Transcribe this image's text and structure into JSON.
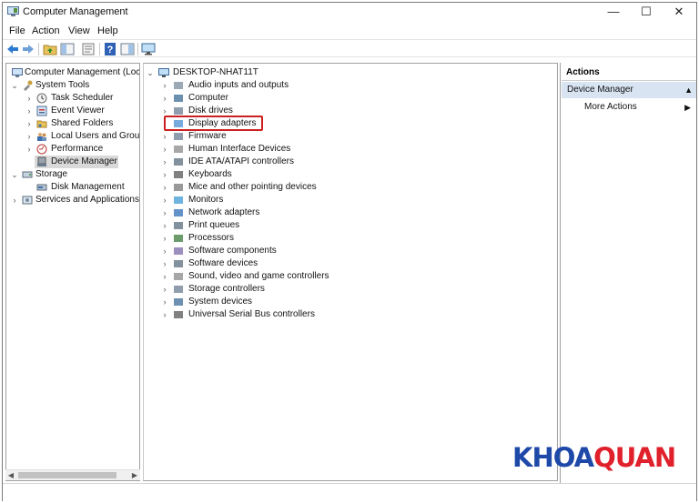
{
  "window": {
    "title": "Computer Management",
    "controls": {
      "minimize": "—",
      "maximize": "☐",
      "close": "✕"
    }
  },
  "menu": [
    "File",
    "Action",
    "View",
    "Help"
  ],
  "toolbar_icons": [
    "back-arrow-icon",
    "forward-arrow-icon",
    "up-folder-icon",
    "show-hide-tree-icon",
    "properties-icon",
    "help-icon",
    "action-pane-icon",
    "monitor-icon"
  ],
  "left_tree": {
    "root": "Computer Management (Local",
    "system_tools": "System Tools",
    "task_scheduler": "Task Scheduler",
    "event_viewer": "Event Viewer",
    "shared_folders": "Shared Folders",
    "local_users": "Local Users and Groups",
    "performance": "Performance",
    "device_manager": "Device Manager",
    "storage": "Storage",
    "disk_management": "Disk Management",
    "services": "Services and Applications"
  },
  "device_tree": {
    "computer_name": "DESKTOP-NHAT11T",
    "categories": [
      "Audio inputs and outputs",
      "Computer",
      "Disk drives",
      "Display adapters",
      "Firmware",
      "Human Interface Devices",
      "IDE ATA/ATAPI controllers",
      "Keyboards",
      "Mice and other pointing devices",
      "Monitors",
      "Network adapters",
      "Print queues",
      "Processors",
      "Software components",
      "Software devices",
      "Sound, video and game controllers",
      "Storage controllers",
      "System devices",
      "Universal Serial Bus controllers"
    ],
    "highlighted": "Display adapters"
  },
  "actions": {
    "header": "Actions",
    "section": "Device Manager",
    "more_actions": "More Actions"
  },
  "watermark": {
    "part1": "KHOA",
    "part2": "QUAN"
  },
  "colors": {
    "selection": "#d8e4f2",
    "highlight_box": "#cc1f1f",
    "watermark_blue": "#1f49a8",
    "watermark_red": "#e0202a"
  }
}
